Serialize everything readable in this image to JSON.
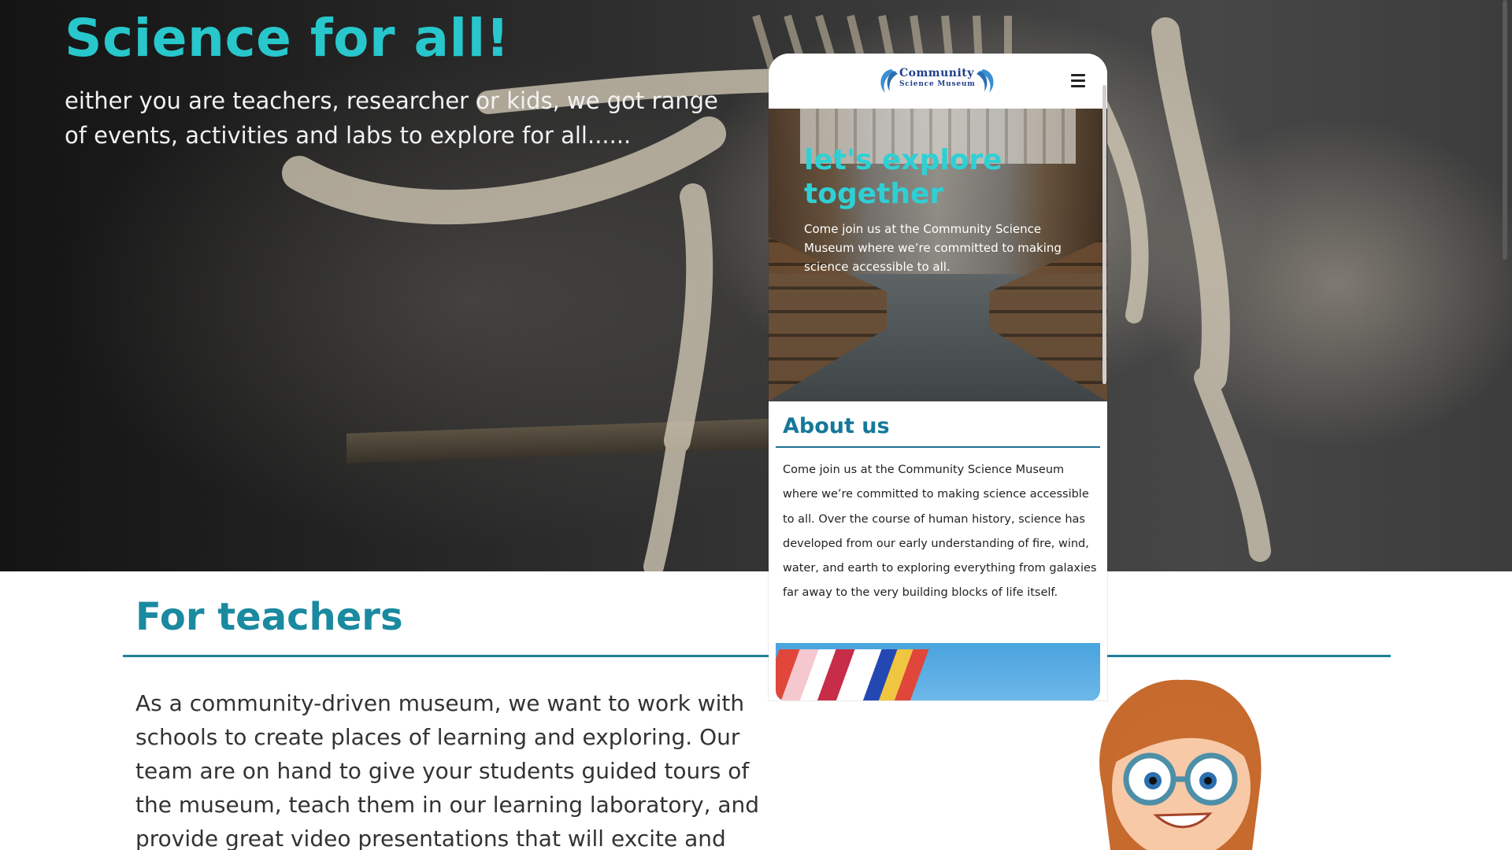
{
  "hero": {
    "title": "Science for all!",
    "text": "either you are teachers, researcher or kids, we got range of events, activities and labs to explore for all......"
  },
  "teachers": {
    "title": "For teachers",
    "text": "As a community-driven museum, we want to work with schools to create places of learning and exploring. Our team are on hand to give your students guided tours of the museum, teach them in our learning laboratory, and provide great video presentations that will excite and"
  },
  "mobile": {
    "logo": {
      "line1": "Community",
      "line2": "Science Museum"
    },
    "hero": {
      "title": "let's explore together",
      "text": "Come join us at the Community Science Museum where we’re committed to making science accessible to all."
    },
    "about": {
      "title": "About us",
      "text": "Come join us at the Community Science Museum where we’re committed to making science accessible to all. Over the course of human history, science has developed from our early understanding of fire, wind, water, and earth to exploring everything from galaxies far away to the very building blocks of life itself."
    }
  },
  "colors": {
    "accent_teal": "#27c7cc",
    "heading_blue": "#1a8aa0",
    "logo_navy": "#1f3f8a"
  },
  "icons": {
    "menu": "hamburger-menu-icon",
    "logo": "museum-logo-icon"
  }
}
